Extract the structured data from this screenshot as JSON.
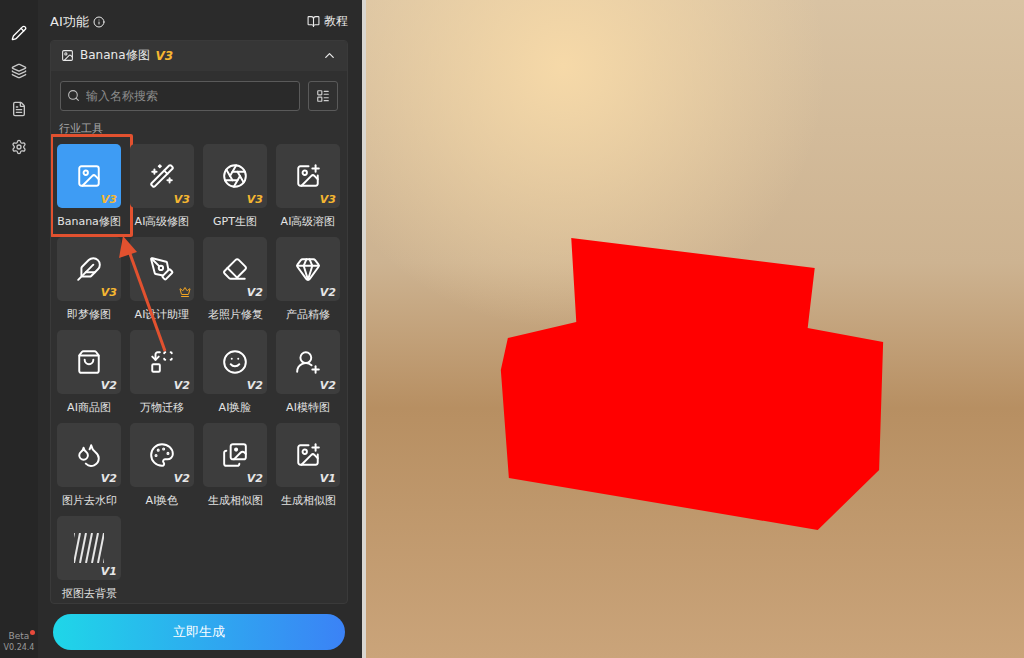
{
  "rail": {
    "items": [
      {
        "kind": "edit",
        "selected": true
      },
      {
        "kind": "layers",
        "selected": false
      },
      {
        "kind": "file",
        "selected": false
      },
      {
        "kind": "settings",
        "selected": false
      }
    ],
    "beta": "Beta",
    "notify": true,
    "version": "V0.24.4"
  },
  "panel": {
    "title": "AI功能",
    "tutorial": "教程"
  },
  "section": {
    "title": "Banana修图",
    "badge": "V3",
    "expanded": true
  },
  "search": {
    "placeholder": "输入名称搜索"
  },
  "group": {
    "label": "行业工具"
  },
  "tools": [
    {
      "label": "Banana修图",
      "badge": "V3",
      "color": "#f5b731",
      "premium": false,
      "selected": true
    },
    {
      "label": "AI高级修图",
      "badge": "V3",
      "color": "#f5b731",
      "premium": false,
      "selected": false
    },
    {
      "label": "GPT生图",
      "badge": "V3",
      "color": "#f5b731",
      "premium": false,
      "selected": false
    },
    {
      "label": "AI高级溶图",
      "badge": "V3",
      "color": "#f5b731",
      "premium": false,
      "selected": false
    },
    {
      "label": "即梦修图",
      "badge": "V3",
      "color": "#f5b731",
      "premium": false,
      "selected": false
    },
    {
      "label": "AI设计助理",
      "badge": "",
      "color": "#f5a623",
      "premium": true,
      "selected": false
    },
    {
      "label": "老照片修复",
      "badge": "V2",
      "color": "#e6e6e6",
      "premium": false,
      "selected": false
    },
    {
      "label": "产品精修",
      "badge": "V2",
      "color": "#e6e6e6",
      "premium": false,
      "selected": false
    },
    {
      "label": "AI商品图",
      "badge": "V2",
      "color": "#e6e6e6",
      "premium": false,
      "selected": false
    },
    {
      "label": "万物迁移",
      "badge": "V2",
      "color": "#e6e6e6",
      "premium": false,
      "selected": false
    },
    {
      "label": "AI换脸",
      "badge": "V2",
      "color": "#e6e6e6",
      "premium": false,
      "selected": false
    },
    {
      "label": "AI模特图",
      "badge": "V2",
      "color": "#e6e6e6",
      "premium": false,
      "selected": false
    },
    {
      "label": "图片去水印",
      "badge": "V2",
      "color": "#e6e6e6",
      "premium": false,
      "selected": false
    },
    {
      "label": "AI换色",
      "badge": "V2",
      "color": "#e6e6e6",
      "premium": false,
      "selected": false
    },
    {
      "label": "生成相似图",
      "badge": "V2",
      "color": "#e6e6e6",
      "premium": false,
      "selected": false
    },
    {
      "label": "生成相似图",
      "badge": "V1",
      "color": "#e6e6e6",
      "premium": false,
      "selected": false
    },
    {
      "label": "抠图去背景",
      "badge": "V1",
      "color": "#e6e6e6",
      "premium": false,
      "selected": false
    }
  ],
  "generate_button": {
    "label": "立即生成"
  }
}
